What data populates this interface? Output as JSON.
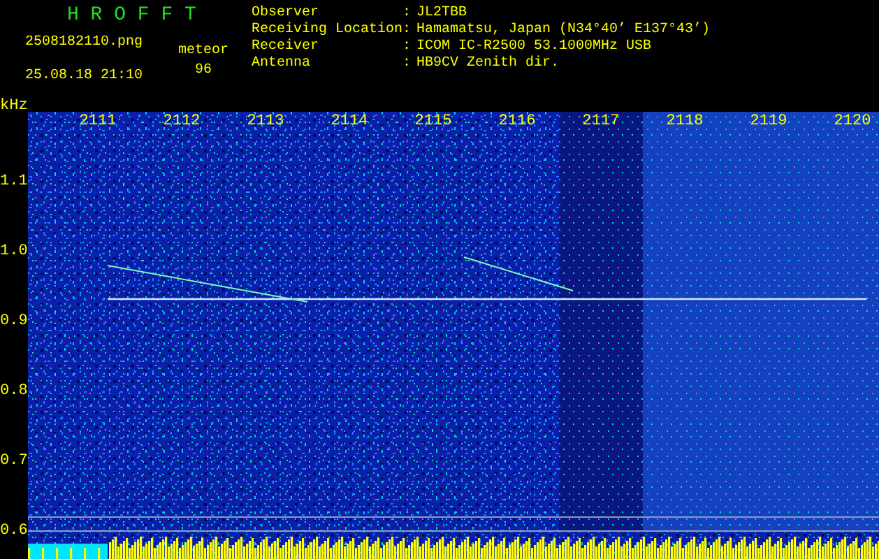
{
  "app_title": "H R O F F T",
  "file_name": "2508182110.png",
  "timestamp": "25.08.18 21:10",
  "meteor_label": "meteor",
  "meteor_count": "96",
  "station_info": [
    {
      "label": "Observer",
      "separator": ":",
      "value": "JL2TBB"
    },
    {
      "label": "Receiving Location",
      "separator": ":",
      "value": "Hamamatsu, Japan (N34°40’ E137°43’)"
    },
    {
      "label": "Receiver",
      "separator": ":",
      "value": "ICOM IC-R2500 53.1000MHz USB"
    },
    {
      "label": "Antenna",
      "separator": ":",
      "value": "HB9CV Zenith dir."
    }
  ],
  "frequency_axis": {
    "unit": "kHz",
    "labels": [
      "1.1",
      "1.0",
      "0.9",
      "0.8",
      "0.7",
      "0.6"
    ]
  },
  "time_axis": {
    "labels": [
      "2111",
      "2112",
      "2113",
      "2114",
      "2115",
      "2116",
      "2117",
      "2118",
      "2119",
      "2120"
    ]
  }
}
